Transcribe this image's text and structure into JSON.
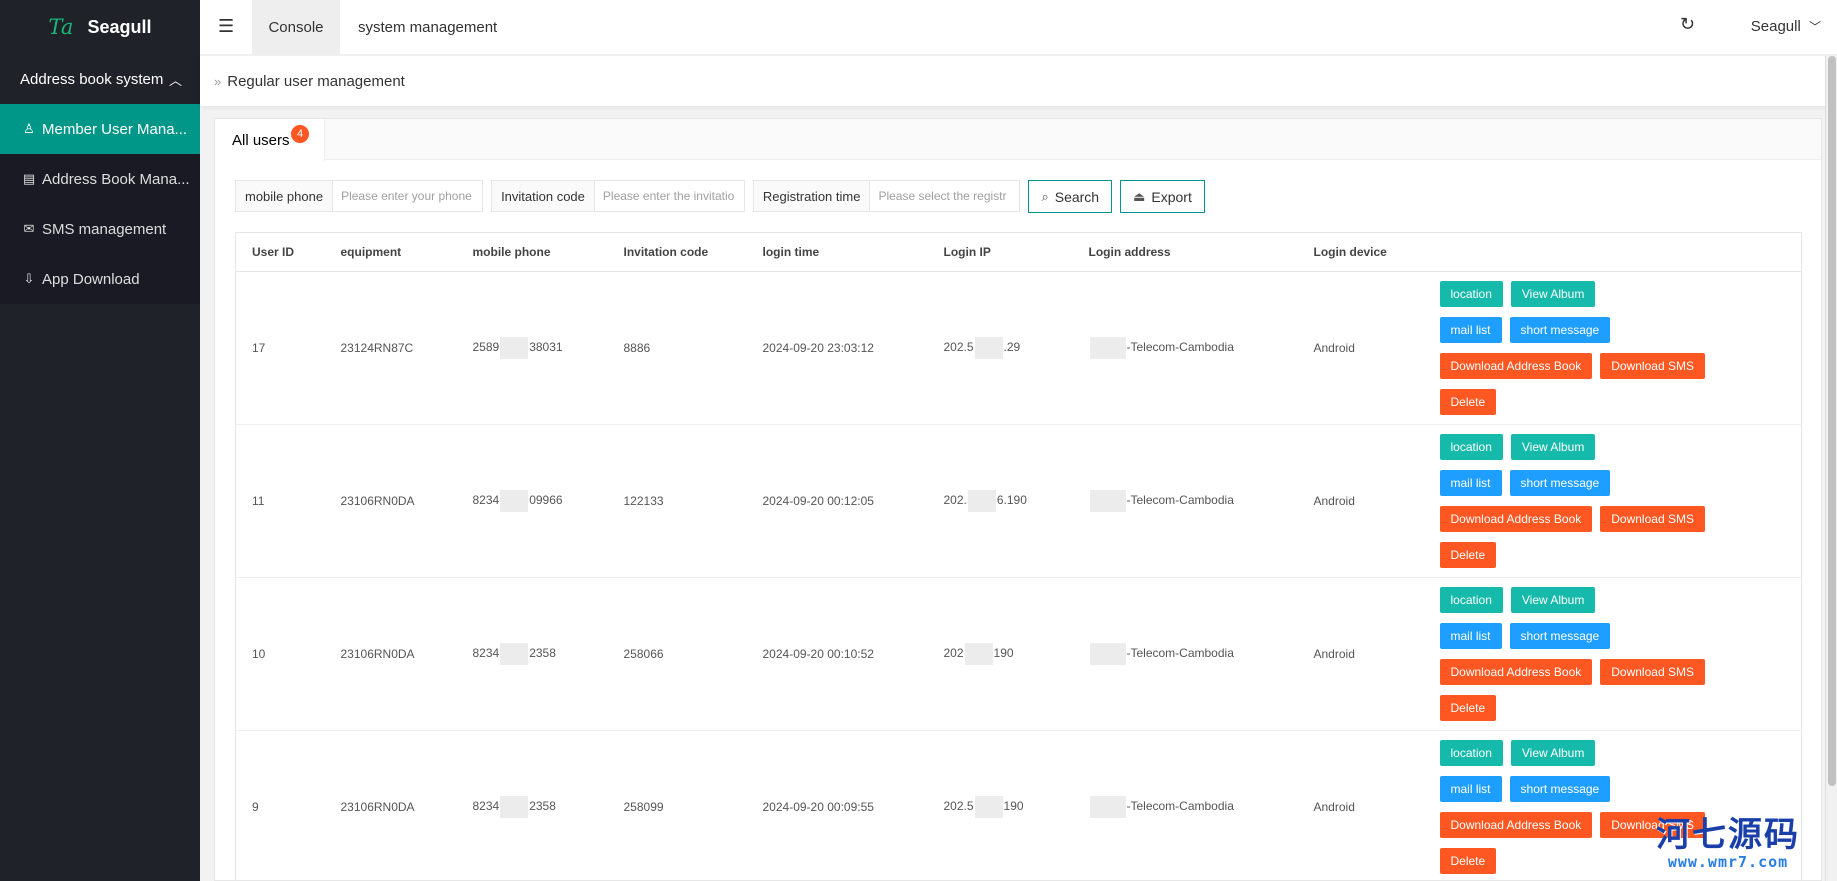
{
  "sidebar": {
    "logo_mark": "Ta",
    "app_name": "Seagull",
    "group_label": "Address book system",
    "items": [
      {
        "label": "Member User Mana...",
        "icon": "user-icon",
        "glyph": "♙",
        "active": true
      },
      {
        "label": "Address Book Mana...",
        "icon": "book-icon",
        "glyph": "▤",
        "active": false
      },
      {
        "label": "SMS management",
        "icon": "message-icon",
        "glyph": "✉",
        "active": false
      },
      {
        "label": "App Download",
        "icon": "download-icon",
        "glyph": "⇩",
        "active": false
      }
    ]
  },
  "header": {
    "tabs": [
      "Console",
      "system management"
    ],
    "user": "Seagull"
  },
  "breadcrumb": "Regular user management",
  "tab": {
    "label": "All users",
    "count": "4"
  },
  "filters": {
    "phone_label": "mobile phone",
    "phone_placeholder": "Please enter your phone",
    "invite_label": "Invitation code",
    "invite_placeholder": "Please enter the invitatio",
    "reg_label": "Registration time",
    "reg_placeholder": "Please select the registr",
    "search_label": "Search",
    "export_label": "Export"
  },
  "table": {
    "columns": [
      "User ID",
      "equipment",
      "mobile phone",
      "Invitation code",
      "login time",
      "Login IP",
      "Login address",
      "Login device",
      ""
    ],
    "rows": [
      {
        "id": "17",
        "equipment": "23124RN87C",
        "phone_a": "2589",
        "phone_b": "38031",
        "code": "8886",
        "time": "2024-09-20 23:03:12",
        "ip_a": "202.5",
        "ip_b": ".29",
        "address": "-Telecom-Cambodia",
        "device": "Android"
      },
      {
        "id": "11",
        "equipment": "23106RN0DA",
        "phone_a": "8234",
        "phone_b": "09966",
        "code": "122133",
        "time": "2024-09-20 00:12:05",
        "ip_a": "202.",
        "ip_b": "6.190",
        "address": "-Telecom-Cambodia",
        "device": "Android"
      },
      {
        "id": "10",
        "equipment": "23106RN0DA",
        "phone_a": "8234",
        "phone_b": "2358",
        "code": "258066",
        "time": "2024-09-20 00:10:52",
        "ip_a": "202",
        "ip_b": "190",
        "address": "-Telecom-Cambodia",
        "device": "Android"
      },
      {
        "id": "9",
        "equipment": "23106RN0DA",
        "phone_a": "8234",
        "phone_b": "2358",
        "code": "258099",
        "time": "2024-09-20 00:09:55",
        "ip_a": "202.5",
        "ip_b": "190",
        "address": "-Telecom-Cambodia",
        "device": "Android"
      }
    ],
    "actions": {
      "location": "location",
      "album": "View Album",
      "mail": "mail list",
      "sms": "short message",
      "dl_book": "Download Address Book",
      "dl_sms": "Download SMS",
      "delete": "Delete"
    }
  },
  "watermark": {
    "title": "河七源码",
    "url": "www.wmr7.com"
  },
  "colors": {
    "sidebar": "#20222a",
    "active": "#009688",
    "teal": "#16baaa",
    "blue": "#1e9fff",
    "orange": "#ff5722"
  }
}
